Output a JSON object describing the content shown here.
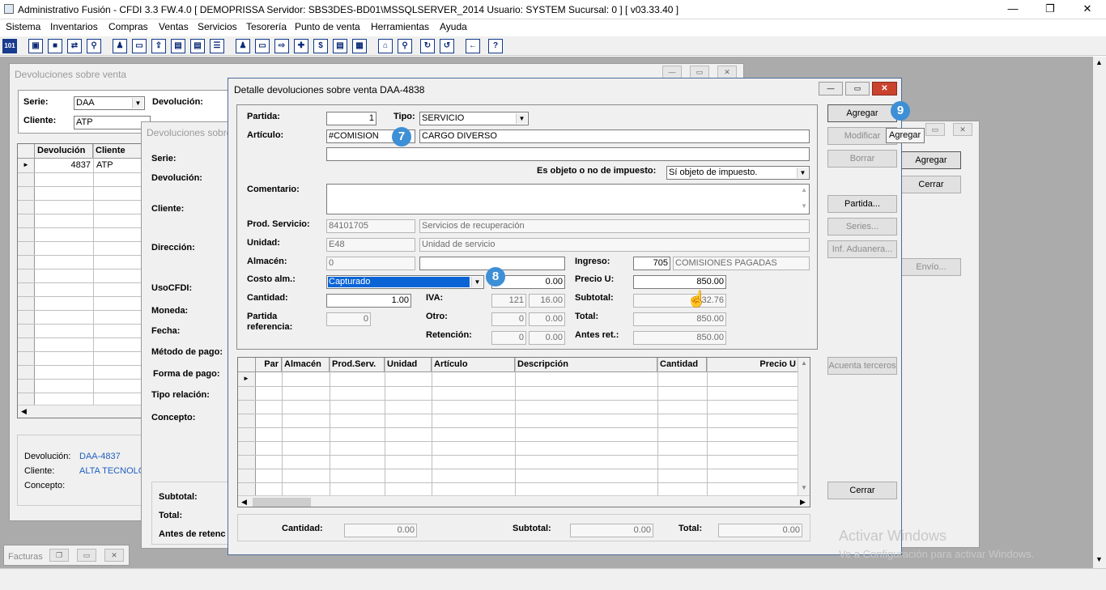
{
  "app": {
    "title": "Administrativo Fusión - CFDI 3.3 FW.4.0 [ DEMOPRISSA   Servidor: SBS3DES-BD01\\MSSQLSERVER_2014   Usuario: SYSTEM      Sucursal: 0 ] [ v03.33.40 ]"
  },
  "menu": [
    "Sistema",
    "Inventarios",
    "Compras",
    "Ventas",
    "Servicios",
    "Tesorería",
    "Punto de venta",
    "Herramientas",
    "Ayuda"
  ],
  "win_back": {
    "title": "Devoluciones sobre venta",
    "serie_label": "Serie:",
    "serie_value": "DAA",
    "devolucion_label": "Devolución:",
    "cliente_label": "Cliente:",
    "cliente_value": "ATP",
    "grid_headers": [
      "Devolución",
      "Cliente"
    ],
    "grid_row": {
      "devolucion": "4837",
      "cliente": "ATP"
    },
    "info": {
      "devolucion_label": "Devolución:",
      "devolucion_value": "DAA-4837",
      "cliente_label": "Cliente:",
      "cliente_value": "ALTA TECNOLO",
      "concepto_label": "Concepto:"
    }
  },
  "win_mid": {
    "title": "Devoluciones sobre",
    "labels": [
      "Serie:",
      "Devolución:",
      "Cliente:",
      "Dirección:",
      "UsoCFDI:",
      "Moneda:",
      "Fecha:",
      "Método de pago:",
      "Forma de pago:",
      "Tipo relación:",
      "Concepto:"
    ],
    "subtotal_label": "Subtotal:",
    "total_label": "Total:",
    "antes_label": "Antes de retenc"
  },
  "win_right": {
    "agregar": "Agregar",
    "cerrar": "Cerrar",
    "envio": "Envío..."
  },
  "factura_min": {
    "title": "Facturas"
  },
  "detail": {
    "title": "Detalle devoluciones sobre venta DAA-4838",
    "partida_label": "Partida:",
    "partida_value": "1",
    "tipo_label": "Tipo:",
    "tipo_value": "SERVICIO",
    "articulo_label": "Artículo:",
    "articulo_code": "#COMISION",
    "articulo_desc": "CARGO DIVERSO",
    "objeto_label": "Es objeto o no de impuesto:",
    "objeto_value": "Sí objeto de impuesto.",
    "comentario_label": "Comentario:",
    "prod_label": "Prod. Servicio:",
    "prod_code": "84101705",
    "prod_desc": "Servicios de recuperación",
    "unidad_label": "Unidad:",
    "unidad_code": "E48",
    "unidad_desc": "Unidad de servicio",
    "almacen_label": "Almacén:",
    "almacen_value": "0",
    "ingreso_label": "Ingreso:",
    "ingreso_code": "705",
    "ingreso_desc": "COMISIONES PAGADAS",
    "costo_label": "Costo alm.:",
    "costo_value": "Capturado",
    "costo_amount": "0.00",
    "precio_label": "Precio U:",
    "precio_value": "850.00",
    "cantidad_label": "Cantidad:",
    "cantidad_value": "1.00",
    "iva_label": "IVA:",
    "iva_a": "121",
    "iva_b": "16.00",
    "subtotal_label": "Subtotal:",
    "subtotal_value": "32.76",
    "partida_ref_label1": "Partida",
    "partida_ref_label2": "referencia:",
    "partida_ref_value": "0",
    "otro_label": "Otro:",
    "otro_a": "0",
    "otro_b": "0.00",
    "total_label": "Total:",
    "total_value": "850.00",
    "retencion_label": "Retención:",
    "retencion_a": "0",
    "retencion_b": "0.00",
    "antes_label": "Antes ret.:",
    "antes_value": "850.00",
    "buttons": {
      "agregar": "Agregar",
      "modificar": "Modificar",
      "borrar": "Borrar",
      "partida": "Partida...",
      "series": "Series...",
      "aduanera": "Inf. Aduanera...",
      "acuenta": "Acuenta terceros",
      "cerrar": "Cerrar"
    },
    "tooltip": "Agregar",
    "grid_headers": [
      "Par",
      "Almacén",
      "Prod.Serv.",
      "Unidad",
      "Artículo",
      "Descripción",
      "Cantidad",
      "Precio U"
    ],
    "footer": {
      "cantidad_label": "Cantidad:",
      "cantidad_value": "0.00",
      "subtotal_label": "Subtotal:",
      "subtotal_value": "0.00",
      "total_label": "Total:",
      "total_value": "0.00"
    }
  },
  "badges": {
    "b7": "7",
    "b8": "8",
    "b9": "9"
  },
  "watermark": {
    "line1": "Activar Windows",
    "line2": "Ve a Configuración para activar Windows."
  }
}
